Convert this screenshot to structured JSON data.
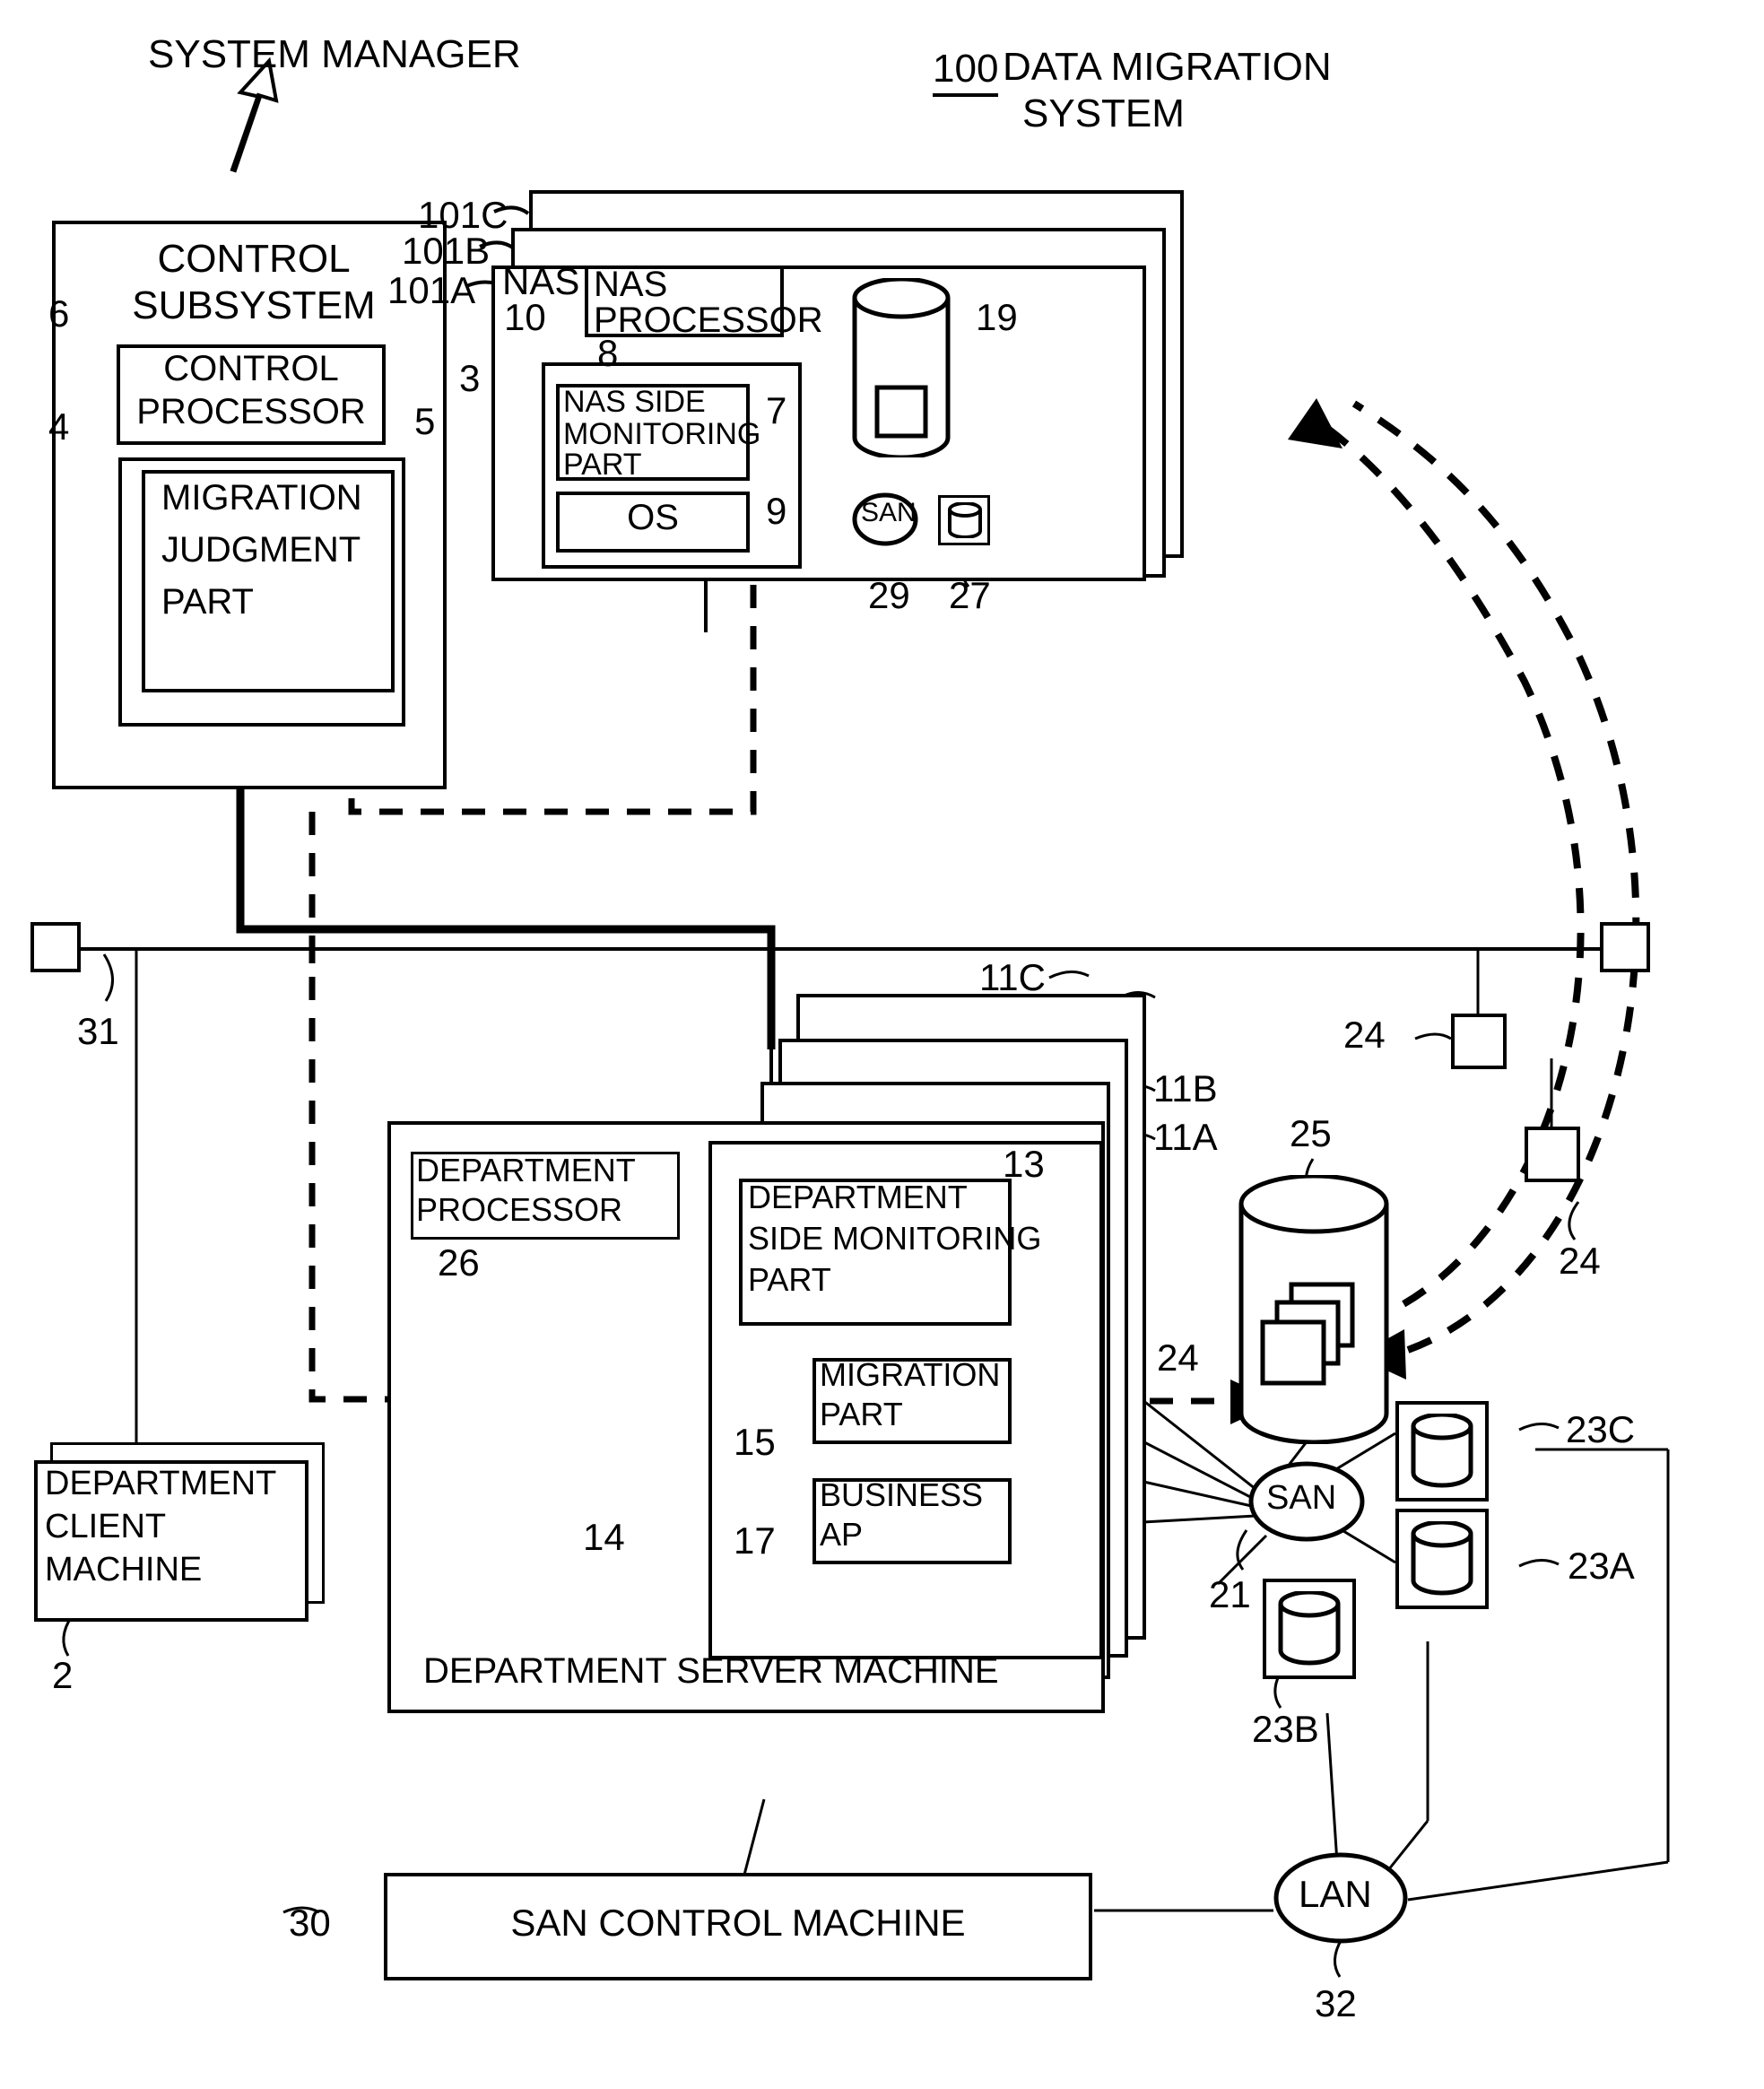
{
  "figure": {
    "title_number": "100",
    "title_text_line1": "DATA MIGRATION",
    "title_text_line2": "SYSTEM",
    "system_manager_label": "SYSTEM MANAGER"
  },
  "control_subsystem": {
    "title_line1": "CONTROL",
    "title_line2": "SUBSYSTEM",
    "ref": "3",
    "control_processor": {
      "line1": "CONTROL",
      "line2": "PROCESSOR",
      "ref": "6"
    },
    "migration_judgment": {
      "line1": "MIGRATION",
      "line2": "JUDGMENT",
      "line3": "PART",
      "outer_ref": "4",
      "inner_ref": "5"
    }
  },
  "nas": {
    "stack_refs": [
      "101C",
      "101B",
      "101A"
    ],
    "label": "NAS",
    "processor": {
      "line1": "NAS",
      "line2": "PROCESSOR",
      "ref": "10"
    },
    "group_ref": "8",
    "monitoring": {
      "line1": "NAS SIDE",
      "line2": "MONITORING",
      "line3": "PART",
      "ref": "7"
    },
    "os": {
      "label": "OS",
      "ref": "9"
    }
  },
  "storage_top": {
    "cylinder_ref": "19",
    "san_label": "SAN",
    "san_ref": "29",
    "disk_ref": "27"
  },
  "network": {
    "node31_ref": "31",
    "node24_refs": [
      "24",
      "24"
    ],
    "bus_ref": "11C"
  },
  "department_server": {
    "stack_refs": [
      "11C",
      "11B",
      "11A"
    ],
    "title": "DEPARTMENT SERVER MACHINE",
    "processor": {
      "line1": "DEPARTMENT",
      "line2": "PROCESSOR",
      "ref": "26"
    },
    "monitoring": {
      "line1": "DEPARTMENT",
      "line2": "SIDE MONITORING",
      "line3": "PART",
      "ref": "13"
    },
    "migration_part": {
      "line1": "MIGRATION",
      "line2": "PART",
      "ref": "15"
    },
    "business_ap": {
      "line1": "BUSINESS",
      "line2": "AP",
      "ref": "17"
    },
    "inner_group_ref": "14"
  },
  "department_client": {
    "line1": "DEPARTMENT",
    "line2": "CLIENT",
    "line3": "MACHINE",
    "ref": "2"
  },
  "storage_bottom": {
    "cylinder_ref": "25",
    "data_ref": "24",
    "san_label": "SAN",
    "san_ref": "21",
    "disks": [
      {
        "ref": "23C"
      },
      {
        "ref": "23A"
      },
      {
        "ref": "23B"
      }
    ]
  },
  "san_control_machine": {
    "label": "SAN CONTROL MACHINE",
    "ref": "30"
  },
  "lan": {
    "label": "LAN",
    "ref": "32"
  }
}
